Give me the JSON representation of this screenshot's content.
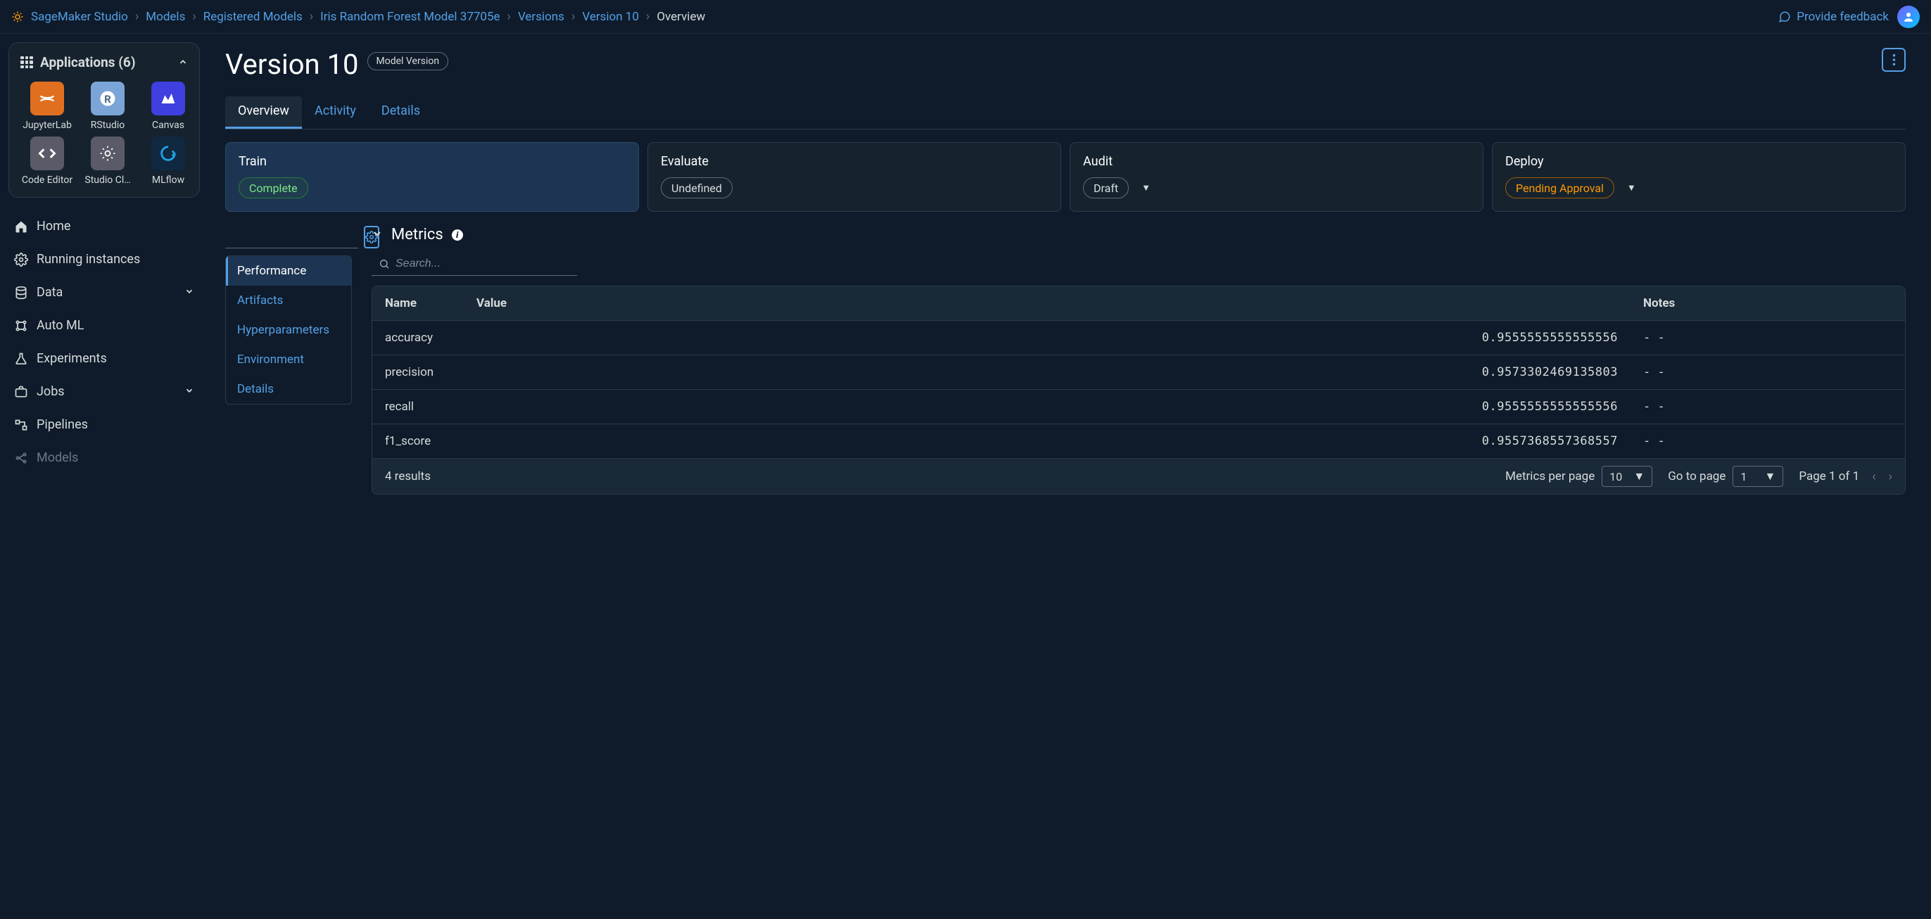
{
  "breadcrumb": {
    "items": [
      "SageMaker Studio",
      "Models",
      "Registered Models",
      "Iris Random Forest Model 37705e",
      "Versions",
      "Version 10"
    ],
    "current": "Overview"
  },
  "feedback_label": "Provide feedback",
  "sidebar": {
    "apps_title": "Applications (6)",
    "apps": [
      {
        "label": "JupyterLab",
        "color": "#e07020"
      },
      {
        "label": "RStudio",
        "color": "#7aa5d6"
      },
      {
        "label": "Canvas",
        "color": "#4040e0"
      },
      {
        "label": "Code Editor",
        "color": "#5a5a68"
      },
      {
        "label": "Studio Cl…",
        "color": "#5a5a68"
      },
      {
        "label": "MLflow",
        "color": "#102840"
      }
    ],
    "nav": [
      {
        "label": "Home"
      },
      {
        "label": "Running instances"
      },
      {
        "label": "Data",
        "expandable": true
      },
      {
        "label": "Auto ML"
      },
      {
        "label": "Experiments"
      },
      {
        "label": "Jobs",
        "expandable": true
      },
      {
        "label": "Pipelines"
      },
      {
        "label": "Models",
        "faded": true
      }
    ]
  },
  "page": {
    "title": "Version 10",
    "badge": "Model Version",
    "tabs": [
      "Overview",
      "Activity",
      "Details"
    ],
    "active_tab": "Overview",
    "stages": [
      {
        "name": "Train",
        "status": "Complete",
        "variant": "green",
        "dropdown": false
      },
      {
        "name": "Evaluate",
        "status": "Undefined",
        "variant": "gray",
        "dropdown": false
      },
      {
        "name": "Audit",
        "status": "Draft",
        "variant": "gray",
        "dropdown": true
      },
      {
        "name": "Deploy",
        "status": "Pending Approval",
        "variant": "orange",
        "dropdown": true
      }
    ],
    "subnav": [
      "Performance",
      "Artifacts",
      "Hyperparameters",
      "Environment",
      "Details"
    ],
    "active_subnav": "Performance",
    "metrics": {
      "title": "Metrics",
      "search_placeholder": "Search...",
      "columns": [
        "Name",
        "Value",
        "Notes"
      ],
      "rows": [
        {
          "name": "accuracy",
          "value": "0.9555555555555556",
          "notes": "- -"
        },
        {
          "name": "precision",
          "value": "0.9573302469135803",
          "notes": "- -"
        },
        {
          "name": "recall",
          "value": "0.9555555555555556",
          "notes": "- -"
        },
        {
          "name": "f1_score",
          "value": "0.9557368557368557",
          "notes": "- -"
        }
      ],
      "results_label": "4 results",
      "per_page_label": "Metrics per page",
      "per_page_value": "10",
      "goto_label": "Go to page",
      "goto_value": "1",
      "page_label": "Page 1 of 1"
    }
  }
}
